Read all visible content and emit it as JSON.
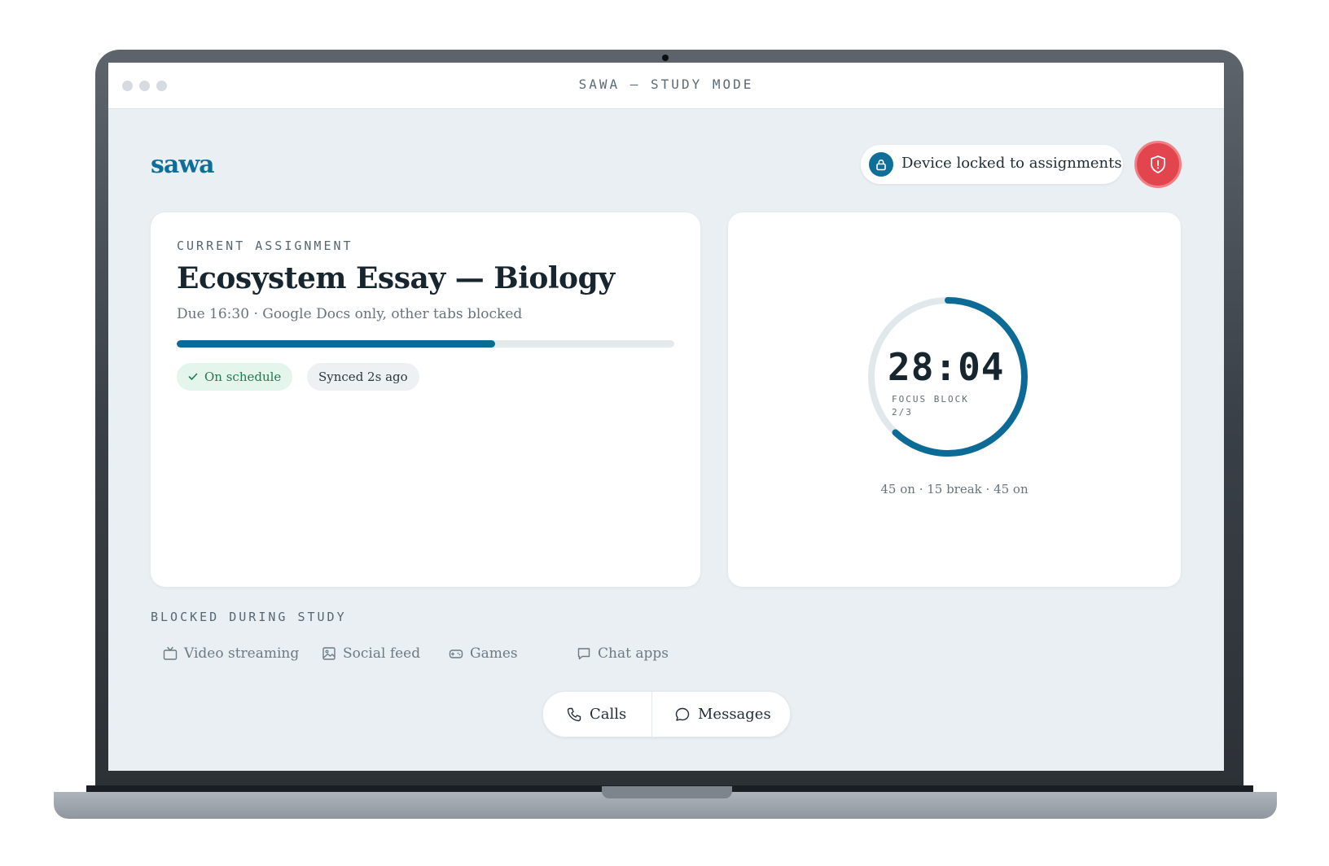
{
  "window": {
    "title": "SAWA — STUDY MODE"
  },
  "brand": {
    "name": "sawa",
    "accent_color": "#0d6e99"
  },
  "header": {
    "lock_status": "Device locked to assignments",
    "lock_icon": "lock-icon",
    "alert_icon": "shield-alert-icon",
    "alert_color": "#e2454e"
  },
  "assignment": {
    "kicker": "CURRENT ASSIGNMENT",
    "title": "Ecosystem Essay — Biology",
    "subtitle": "Due 16:30 · Google Docs only, other tabs blocked",
    "progress": 0.64,
    "status_chip": "On schedule",
    "sync_chip": "Synced 2s ago"
  },
  "timer": {
    "value": "28:04",
    "label": "FOCUS BLOCK 2/3",
    "schedule": "45 on · 15 break · 45 on",
    "elapsed_fraction": 0.62,
    "ring_color": "#0b6b96"
  },
  "blocked": {
    "heading": "BLOCKED DURING STUDY",
    "items": [
      {
        "label": "Video streaming",
        "icon": "tv-icon"
      },
      {
        "label": "Social feed",
        "icon": "image-icon"
      },
      {
        "label": "Games",
        "icon": "gamepad-icon"
      },
      {
        "label": "Chat apps",
        "icon": "chat-icon"
      }
    ]
  },
  "communication": {
    "calls_label": "Calls",
    "messages_label": "Messages"
  }
}
